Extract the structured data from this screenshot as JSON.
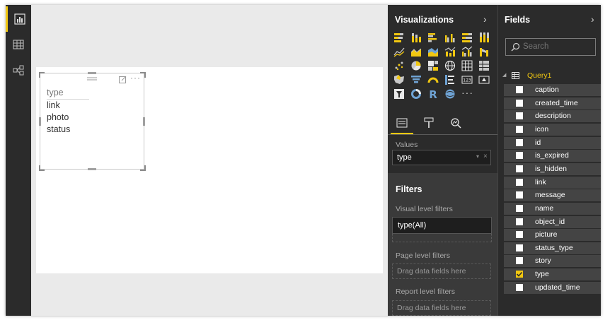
{
  "viz_pane": {
    "title": "Visualizations",
    "values_label": "Values",
    "value_field": "type",
    "filters_title": "Filters",
    "visual_filters_label": "Visual level filters",
    "visual_filter_value": "type(All)",
    "page_filters_label": "Page level filters",
    "page_filters_drop": "Drag data fields here",
    "report_filters_label": "Report level filters",
    "report_filters_drop": "Drag data fields here"
  },
  "fields_pane": {
    "title": "Fields",
    "search_placeholder": "Search",
    "table_name": "Query1",
    "fields": [
      {
        "name": "caption",
        "checked": false
      },
      {
        "name": "created_time",
        "checked": false
      },
      {
        "name": "description",
        "checked": false
      },
      {
        "name": "icon",
        "checked": false
      },
      {
        "name": "id",
        "checked": false
      },
      {
        "name": "is_expired",
        "checked": false
      },
      {
        "name": "is_hidden",
        "checked": false
      },
      {
        "name": "link",
        "checked": false
      },
      {
        "name": "message",
        "checked": false
      },
      {
        "name": "name",
        "checked": false
      },
      {
        "name": "object_id",
        "checked": false
      },
      {
        "name": "picture",
        "checked": false
      },
      {
        "name": "status_type",
        "checked": false
      },
      {
        "name": "story",
        "checked": false
      },
      {
        "name": "type",
        "checked": true
      },
      {
        "name": "updated_time",
        "checked": false
      }
    ]
  },
  "visual": {
    "header": "type",
    "items": [
      "link",
      "photo",
      "status"
    ]
  },
  "colors": {
    "accent": "#f2c811",
    "pane_bg": "#2b2b2b"
  }
}
